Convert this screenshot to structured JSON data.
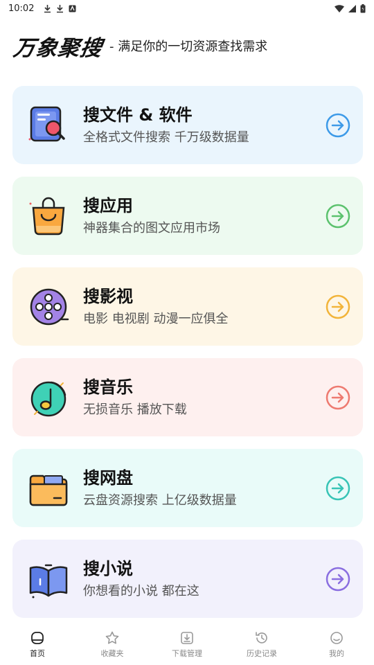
{
  "status_bar": {
    "time": "10:02"
  },
  "header": {
    "logo": "万象聚搜",
    "slogan": "- 满足你的一切资源查找需求"
  },
  "colors": {
    "card_file": "#eaf5fd",
    "card_app": "#edfaf0",
    "card_video": "#fef6e6",
    "card_music": "#fef0ef",
    "card_disk": "#e9fbf9",
    "card_novel": "#f2f1fc",
    "arrow_file": "#3d9ae8",
    "arrow_app": "#5cc26e",
    "arrow_video": "#f2b43a",
    "arrow_music": "#ee7a70",
    "arrow_disk": "#38c4b6",
    "arrow_novel": "#8a6ee0"
  },
  "cards": [
    {
      "title": "搜文件 & 软件",
      "sub": "全格式文件搜索 千万级数据量",
      "icon": "document-search-icon"
    },
    {
      "title": "搜应用",
      "sub": "神器集合的图文应用市场",
      "icon": "shopping-bag-icon"
    },
    {
      "title": "搜影视",
      "sub": "电影 电视剧 动漫一应俱全",
      "icon": "film-reel-icon"
    },
    {
      "title": "搜音乐",
      "sub": "无损音乐 播放下载",
      "icon": "music-note-icon"
    },
    {
      "title": "搜网盘",
      "sub": "云盘资源搜索 上亿级数据量",
      "icon": "folder-icon"
    },
    {
      "title": "搜小说",
      "sub": "你想看的小说 都在这",
      "icon": "book-icon"
    }
  ],
  "nav": [
    {
      "label": "首页",
      "icon": "home-icon",
      "active": true
    },
    {
      "label": "收藏夹",
      "icon": "star-icon",
      "active": false
    },
    {
      "label": "下载管理",
      "icon": "download-icon",
      "active": false
    },
    {
      "label": "历史记录",
      "icon": "history-icon",
      "active": false
    },
    {
      "label": "我的",
      "icon": "profile-icon",
      "active": false
    }
  ]
}
